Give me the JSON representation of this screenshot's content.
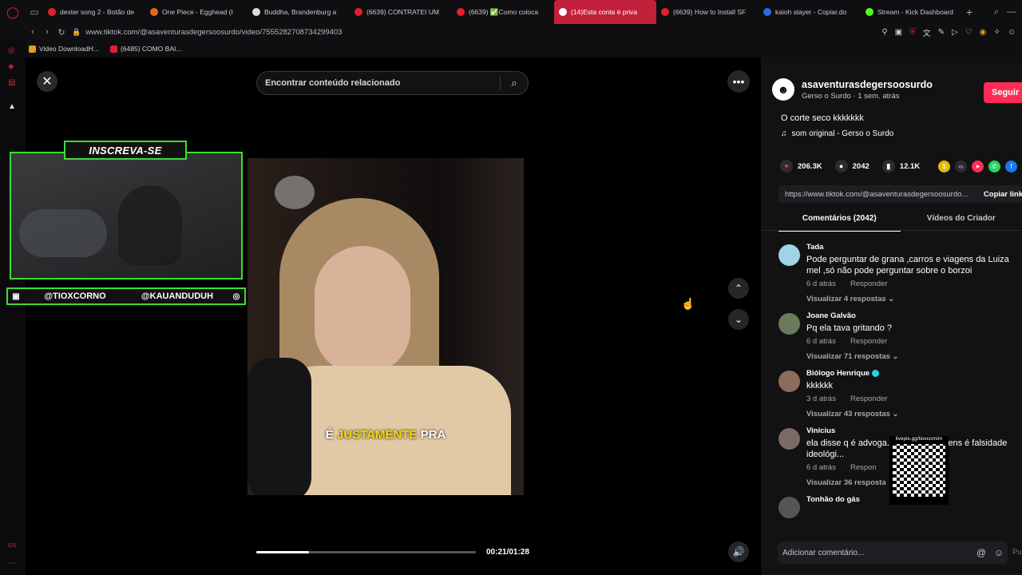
{
  "browser": {
    "tabs": [
      {
        "title": "dexter song 2 - Botão de",
        "color": "#e0202f"
      },
      {
        "title": "One Piece - Egghead (I",
        "color": "#e06a20"
      },
      {
        "title": "Buddha, Brandenburg a",
        "color": "#dddddd"
      },
      {
        "title": "(6639) CONTRATEI UM",
        "color": "#e0202f"
      },
      {
        "title": "(6639) ✅Como coloca",
        "color": "#e0202f"
      },
      {
        "title": "(14)Esta conta é priva",
        "color": "#ffffff",
        "active": true
      },
      {
        "title": "(6639) How to Install SF",
        "color": "#e0202f"
      },
      {
        "title": "kaioh slayer - Copiar.do",
        "color": "#2d6ae0"
      },
      {
        "title": "Stream - Kick Dashboard",
        "color": "#53fc18"
      }
    ],
    "url": "www.tiktok.com/@asaventurasdegersoosurdo/video/7555282708734299403",
    "bookmarks": [
      "Video DownloadH...",
      "(6485) COMO BAI..."
    ]
  },
  "overlay": {
    "title": "INSCREVA-SE",
    "handle_left": "@TIOXCORNO",
    "handle_right": "@KAUANDUDUH"
  },
  "search": {
    "placeholder": "Encontrar conteúdo relacionado"
  },
  "video": {
    "caption_pre": "É",
    "caption_hl": "JUSTAMENTE",
    "caption_post": "PRA",
    "time": "00:21/01:28",
    "progress": 0.24
  },
  "author": {
    "username": "asaventurasdegersoosurdo",
    "subline": "Gerso o Surdo · 1 sem. atrás",
    "follow_label": "Seguir",
    "description": "O corte seco kkkkkkk",
    "sound": "som original - Gerso o Surdo"
  },
  "stats": {
    "likes": "206.3K",
    "comments": "2042",
    "saves": "12.1K"
  },
  "link": {
    "url": "https://www.tiktok.com/@asaventurasdegersoosurdo...",
    "copy_label": "Copiar link"
  },
  "panel_tabs": [
    "Comentários (2042)",
    "Vídeos do Criador"
  ],
  "comments": [
    {
      "name": "Tada",
      "text": "Pode perguntar de grana ,carros e viagens da Luiza mel ,só não pode perguntar sobre o borzoi",
      "time": "6 d atrás",
      "reply": "Responder",
      "replies": "Visualizar 4 respostas ⌄",
      "avatar": "#9fd3e6"
    },
    {
      "name": "Joane Galvão",
      "text": "Pq ela tava gritando ?",
      "time": "6 d atrás",
      "reply": "Responder",
      "replies": "Visualizar 71 respostas ⌄",
      "avatar": "#6b7a5a"
    },
    {
      "name": "Biólogo Henrique",
      "text": "kkkkkk",
      "time": "3 d atrás",
      "reply": "Responder",
      "replies": "Visualizar 43 respostas ⌄",
      "avatar": "#8a6d5c"
    },
    {
      "name": "Vinicius",
      "text": "ela disse q é advoga... ao declarar bens é falsidade ideológi...",
      "time": "6 d atrás",
      "reply": "Respon",
      "replies": "Visualizar 36 resposta",
      "avatar": "#7c6a66"
    },
    {
      "name": "Tonhão do gás",
      "text": "",
      "time": "",
      "reply": "",
      "replies": "",
      "avatar": "#555555"
    }
  ],
  "qr": {
    "label": "livepix.gg/tioxcornim"
  },
  "add_comment": {
    "placeholder": "Adicionar comentário...",
    "post": "Publicar"
  }
}
